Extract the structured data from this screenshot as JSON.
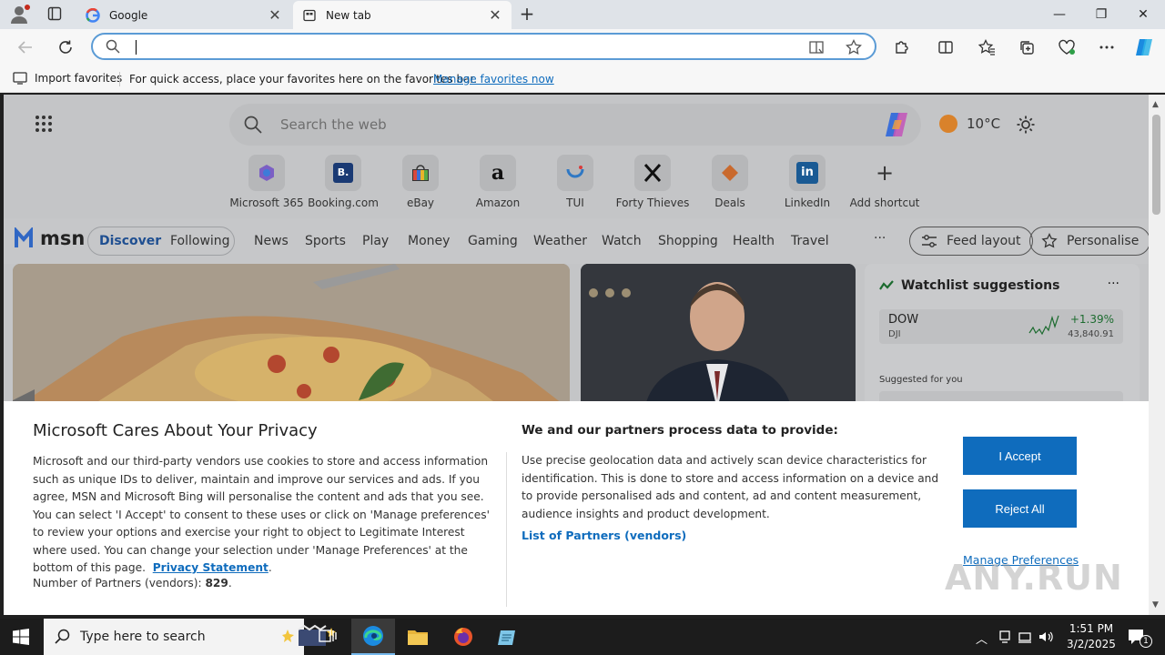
{
  "browser": {
    "tabs": [
      {
        "title": "Google",
        "close": "✕"
      },
      {
        "title": "New tab",
        "close": "✕"
      }
    ],
    "new_tab": "+",
    "window_controls": {
      "minimize": "—",
      "maximize": "❐",
      "close": "✕"
    },
    "address_value": ""
  },
  "favorites_bar": {
    "import_label": "Import favorites",
    "hint": "For quick access, place your favorites here on the favorites bar.",
    "manage_link": "Manage favorites now"
  },
  "newtab": {
    "search_placeholder": "Search the web",
    "weather": "10°C",
    "shortcuts": [
      {
        "label": "Microsoft 365",
        "icon": "microsoft-365-icon"
      },
      {
        "label": "Booking.com",
        "icon": "booking-icon",
        "glyph": "B."
      },
      {
        "label": "eBay",
        "icon": "ebay-icon"
      },
      {
        "label": "Amazon",
        "icon": "amazon-icon",
        "glyph": "a"
      },
      {
        "label": "TUI",
        "icon": "tui-icon"
      },
      {
        "label": "Forty Thieves",
        "icon": "forty-thieves-icon"
      },
      {
        "label": "Deals",
        "icon": "deals-icon"
      },
      {
        "label": "LinkedIn",
        "icon": "linkedin-icon",
        "glyph": "in"
      },
      {
        "label": "Add shortcut",
        "icon": "plus-icon",
        "glyph": "+"
      }
    ],
    "msn": {
      "logo": "msn",
      "feed_tabs": [
        "Discover",
        "Following"
      ],
      "nav": [
        "News",
        "Sports",
        "Play",
        "Money",
        "Gaming",
        "Weather",
        "Watch",
        "Shopping",
        "Health",
        "Travel"
      ],
      "more": "···",
      "feed_layout": "Feed layout",
      "personalise": "Personalise"
    },
    "watchlist": {
      "title": "Watchlist suggestions",
      "more": "···",
      "row": {
        "symbol": "DOW",
        "exchange": "DJI",
        "change": "+1.39%",
        "value": "43,840.91"
      },
      "suggested": "Suggested for you"
    }
  },
  "privacy": {
    "title": "Microsoft Cares About Your Privacy",
    "body": "Microsoft and our third-party vendors use cookies to store and access information such as unique IDs to deliver, maintain and improve our services and ads. If you agree, MSN and Microsoft Bing will personalise the content and ads that you see. You can select 'I Accept' to consent to these uses or click on 'Manage preferences' to review your options and exercise your right to object to Legitimate Interest where used.  You can change your selection under 'Manage Preferences' at the bottom of this page.",
    "privacy_link": "Privacy Statement",
    "partners_label": "Number of Partners (vendors):",
    "partners_count": "829",
    "right_title": "We and our partners process data to provide:",
    "right_body": "Use precise geolocation data and actively scan device characteristics for identification. This is done to store and access information on a device and to provide personalised ads and content, ad and content measurement, audience insights and product development.",
    "partners_list_link": "List of Partners (vendors)",
    "accept": "I Accept",
    "reject": "Reject All",
    "manage": "Manage Preferences"
  },
  "watermark": "ANY.RUN",
  "taskbar": {
    "search_placeholder": "Type here to search",
    "time": "1:51 PM",
    "date": "3/2/2025",
    "notification_count": "1"
  },
  "colors": {
    "accent": "#0f6cbd",
    "address_border": "#5b9bd5",
    "taskbar": "#1c1c1c"
  }
}
